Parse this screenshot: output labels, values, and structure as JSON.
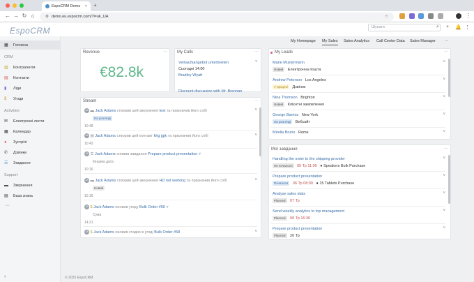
{
  "browser": {
    "tab_title": "EspoCRM Demo",
    "url": "demo.eu.espocrm.com/?l=uk_UA",
    "colors": {
      "red": "#ff5f57",
      "yellow": "#febc2e",
      "green": "#28c840"
    }
  },
  "app": {
    "logo": "EspoCRM",
    "search_placeholder": "Шукати",
    "footer": "© 2025 EspoCRM"
  },
  "sidebar": {
    "home": "Головна",
    "group_crm": "CRM",
    "items_crm": [
      "Контрагенти",
      "Контакти",
      "Ліди",
      "Угоди"
    ],
    "group_activities": "Activities",
    "items_act": [
      "Електронні листи",
      "Календар",
      "Зустрічі",
      "Дзвінки",
      "Завдання"
    ],
    "group_support": "Support",
    "items_support": [
      "Звернення",
      "База знань"
    ],
    "more": "···"
  },
  "tabs": [
    "My Homepage",
    "My Sales",
    "Sales Analytics",
    "Call Center Data",
    "Sales Manager"
  ],
  "revenue": {
    "title": "Revenue",
    "value": "€82.8k",
    "value_color": "#5fb88a"
  },
  "calls": {
    "title": "My Calls",
    "item_name": "Verkaufsangebot unterbreiten",
    "item_time": "Сьогодні 14:00",
    "item_contact": "Bradley Wyatt",
    "next_item": "Discount discussion with Mr. Brennan"
  },
  "leads": {
    "title": "My Leads",
    "rows": [
      {
        "name": "Marie Mustermann",
        "city": "",
        "status": "Новий",
        "source": "Електронна пошта"
      },
      {
        "name": "Andrew Peterson",
        "city": "Los Angeles",
        "status": "У процесі",
        "source": "Дзвінок"
      },
      {
        "name": "Nina Thomson",
        "city": "Brighton",
        "status": "Новий",
        "source": "Клієнтні замовлення"
      },
      {
        "name": "George Barrios",
        "city": "New York",
        "status": "На розгляді",
        "source": "Вебсайт"
      },
      {
        "name": "Mirella Bruno",
        "city": "Rome",
        "status": "",
        "source": ""
      }
    ]
  },
  "tasks": {
    "title": "Мої завдання",
    "rows": [
      {
        "name": "Handling the order to the shipping provider",
        "status": "Не почалося",
        "date": "05 Тр 11:00",
        "related": "Speakers Bulk Purchase"
      },
      {
        "name": "Prepare product presentation",
        "status": "Почалося",
        "date": "06 Тр 08:00",
        "related": "15 Tablets Purchase"
      },
      {
        "name": "Analyse sales stats",
        "status": "Planned",
        "date": "07 Тр",
        "related": ""
      },
      {
        "name": "Send weekly analytics to top management",
        "status": "Planned",
        "date": "08 Тр 16:30",
        "related": ""
      },
      {
        "name": "Prepare product presentation",
        "status": "Planned",
        "date": "20 Тр",
        "related": ""
      }
    ]
  },
  "stream": {
    "title": "Stream",
    "items": [
      {
        "user": "Jack Adams",
        "action": "створив цей звернення",
        "target": "test",
        "tail": "та призначив його собі",
        "badge": "На розгляді",
        "time": "10:48"
      },
      {
        "user": "Jack Adams",
        "action": "створив цей контакт",
        "target": "khg jgjk",
        "tail": "та призначив його собі",
        "badge": "",
        "time": "10:43"
      },
      {
        "user": "Jack Adams",
        "action": "оновив завдання",
        "target": "Prepare product presentation",
        "tail": "",
        "badge": "",
        "sub": "Кінцева дата",
        "time": "10:16"
      },
      {
        "user": "Jack Adams",
        "action": "створив цей звернення",
        "target": "HD not working",
        "tail": "та призначив його собі",
        "badge": "Новий",
        "time": "10:16"
      },
      {
        "user": "Jack Adams",
        "action": "оновив угоду",
        "target": "Bulk Order #56",
        "tail": "",
        "badge": "",
        "sub": "Сума",
        "time": "14:21"
      },
      {
        "user": "Jack Adams",
        "action": "оновив стадію в угоді",
        "target": "Bulk Order #58",
        "tail": "",
        "badge": "",
        "time": ""
      }
    ]
  }
}
